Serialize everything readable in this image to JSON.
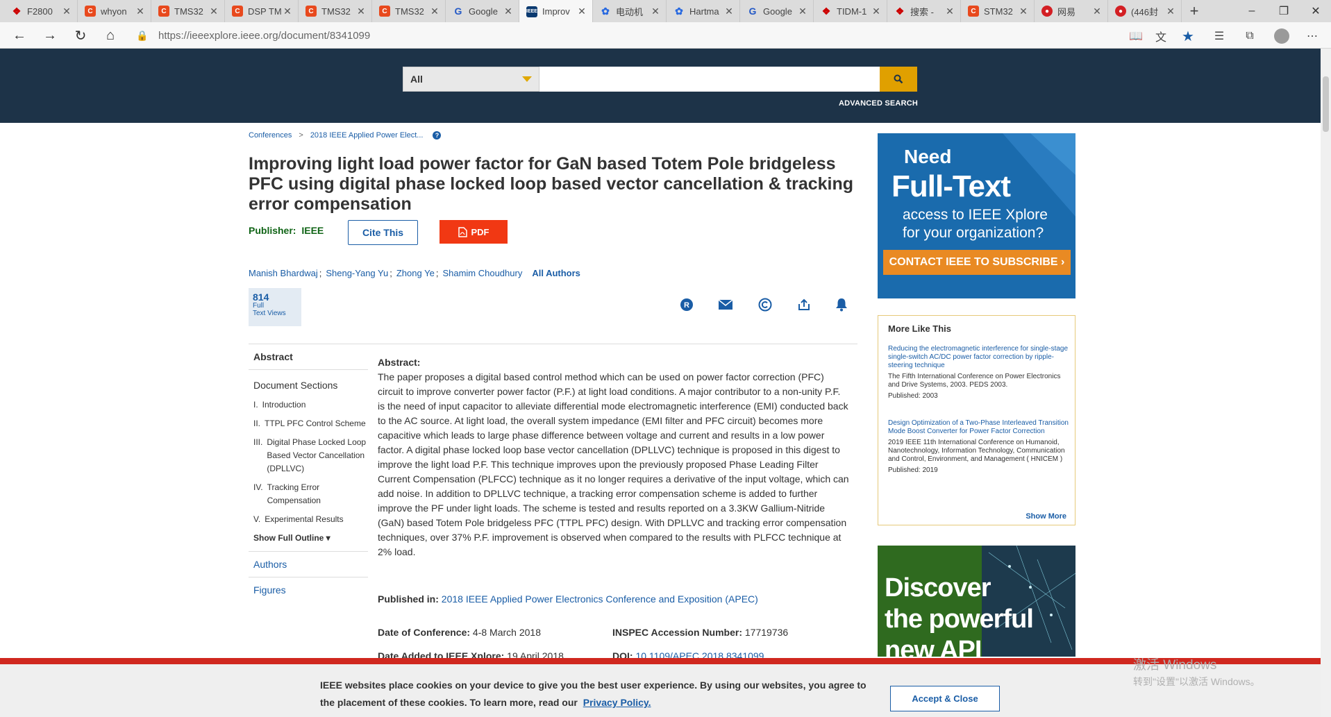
{
  "browser": {
    "tabs": [
      {
        "label": "F2800",
        "icon": "ti-icon"
      },
      {
        "label": "whyon",
        "icon": "csdn-icon"
      },
      {
        "label": "TMS32",
        "icon": "csdn-icon"
      },
      {
        "label": "DSP TM",
        "icon": "csdn-icon"
      },
      {
        "label": "TMS32",
        "icon": "csdn-icon"
      },
      {
        "label": "TMS32",
        "icon": "csdn-icon"
      },
      {
        "label": "Google",
        "icon": "translate-icon"
      },
      {
        "label": "Improv",
        "icon": "ieee-icon"
      },
      {
        "label": "电动机",
        "icon": "baidu-icon"
      },
      {
        "label": "Hartma",
        "icon": "baidu-icon"
      },
      {
        "label": "Google",
        "icon": "translate-icon"
      },
      {
        "label": "TIDM-1",
        "icon": "ti-icon"
      },
      {
        "label": "搜索 - ",
        "icon": "ti-icon"
      },
      {
        "label": "STM32",
        "icon": "csdn-icon"
      },
      {
        "label": "网易",
        "icon": "netease-icon"
      },
      {
        "label": "(446封",
        "icon": "netease-icon"
      }
    ],
    "active_tab_index": 7,
    "url": "https://ieeexplore.ieee.org/document/8341099"
  },
  "header": {
    "search_scope": "All",
    "search_value": "",
    "advanced_search": "ADVANCED SEARCH"
  },
  "breadcrumb": {
    "first": "Conferences",
    "separator": ">",
    "second": "2018 IEEE Applied Power Elect...",
    "help": "?"
  },
  "article": {
    "title": "Improving light load power factor for GaN based Totem Pole bridgeless PFC using digital phase locked loop based vector cancellation & tracking error compensation",
    "publisher_label": "Publisher:",
    "publisher_value": "IEEE",
    "cite_label": "Cite This",
    "pdf_label": "PDF",
    "authors": [
      "Manish Bhardwaj",
      "Sheng-Yang Yu",
      "Zhong Ye",
      "Shamim Choudhury"
    ],
    "author_sep": ";",
    "all_authors": "All Authors",
    "views": {
      "count": "814",
      "line1": "Full",
      "line2": "Text Views"
    }
  },
  "leftnav": {
    "abstract": "Abstract",
    "sections_title": "Document Sections",
    "sections": [
      {
        "num": "I.",
        "label": "Introduction"
      },
      {
        "num": "II.",
        "label": "TTPL PFC Control Scheme"
      },
      {
        "num": "III.",
        "label": "Digital Phase Locked Loop Based Vector Cancellation (DPLLVC)"
      },
      {
        "num": "IV.",
        "label": "Tracking Error Compensation"
      },
      {
        "num": "V.",
        "label": "Experimental Results"
      }
    ],
    "show_outline": "Show Full Outline ▾",
    "authors": "Authors",
    "figures": "Figures"
  },
  "abstract": {
    "heading": "Abstract:",
    "text": "The paper proposes a digital based control method which can be used on power factor correction (PFC) circuit to improve converter power factor (P.F.) at light load conditions. A major contributor to a non-unity P.F. is the need of input capacitor to alleviate differential mode electromagnetic interference (EMI) conducted back to the AC source. At light load, the overall system impedance (EMI filter and PFC circuit) becomes more capacitive which leads to large phase difference between voltage and current and results in a low power factor. A digital phase locked loop base vector cancellation (DPLLVC) technique is proposed in this digest to improve the light load P.F. This technique improves upon the previously proposed Phase Leading Filter Current Compensation (PLFCC) technique as it no longer requires a derivative of the input voltage, which can add noise. In addition to DPLLVC technique, a tracking error compensation scheme is added to further improve the PF under light loads. The scheme is tested and results reported on a 3.3KW Gallium-Nitride (GaN) based Totem Pole bridgeless PFC (TTPL PFC) design. With DPLLVC and tracking error compensation techniques, over 37% P.F. improvement is observed when compared to the results with PLFCC technique at 2% load.",
    "published_in_label": "Published in:",
    "published_in_value": "2018 IEEE Applied Power Electronics Conference and Exposition (APEC)",
    "date_conf_label": "Date of Conference:",
    "date_conf_value": "4-8 March 2018",
    "inspec_label": "INSPEC Accession Number:",
    "inspec_value": "17719736",
    "date_added_label": "Date Added to IEEE Xplore:",
    "date_added_value": "19 April 2018",
    "doi_label": "DOI:",
    "doi_value": "10.1109/APEC.2018.8341099"
  },
  "ad_fulltext": {
    "line1": "Need",
    "line2": "Full-Text",
    "line3": "access to IEEE Xplore",
    "line4": "for your organization?",
    "cta": "CONTACT IEEE TO SUBSCRIBE ›"
  },
  "more_like_this": {
    "heading": "More Like This",
    "items": [
      {
        "title": "Reducing the electromagnetic interference for single-stage single-switch AC/DC power factor correction by ripple-steering technique",
        "conference": "The Fifth International Conference on Power Electronics and Drive Systems, 2003. PEDS 2003.",
        "published": "Published: 2003"
      },
      {
        "title": "Design Optimization of a Two-Phase Interleaved Transition Mode Boost Converter for Power Factor Correction",
        "conference": "2019 IEEE 11th International Conference on Humanoid, Nanotechnology, Information Technology, Communication and Control, Environment, and Management ( HNICEM )",
        "published": "Published: 2019"
      }
    ],
    "show_more": "Show More"
  },
  "ad_api": {
    "line1": "Discover",
    "line2": "the powerful",
    "line3": "new API"
  },
  "cookie": {
    "text": "IEEE websites place cookies on your device to give you the best user experience. By using our websites, you agree to the placement of these cookies. To learn more, read our",
    "privacy_link": "Privacy Policy.",
    "accept": "Accept & Close"
  },
  "windows_watermark": {
    "line1": "激活 Windows",
    "line2": "转到\"设置\"以激活 Windows。"
  },
  "colors": {
    "header_bg": "#1d3348",
    "link": "#1a5da6",
    "pdf": "#f13813",
    "publisher": "#106416",
    "search_button": "#e0a000",
    "cookie_bar": "#d0281f"
  }
}
